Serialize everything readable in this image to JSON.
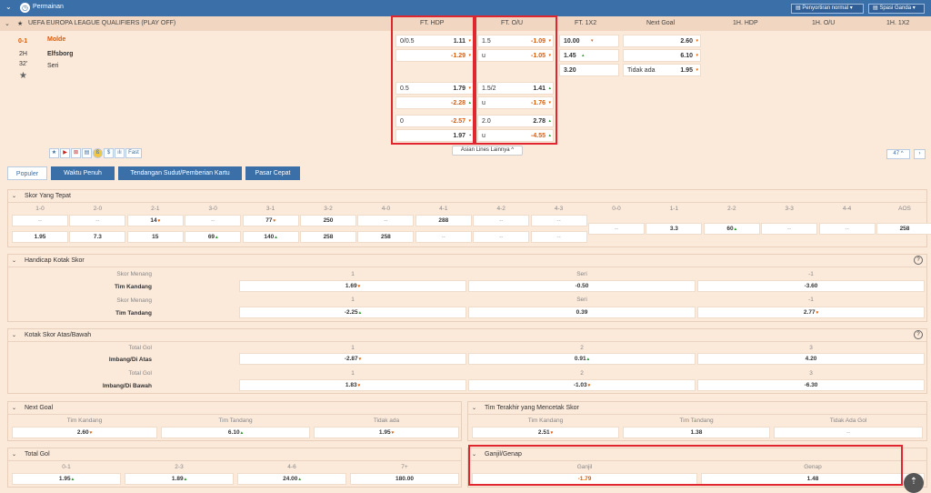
{
  "topbar": {
    "title": "Permainan",
    "sort": "Penyortiran normal",
    "spread": "Spasi Ganda"
  },
  "header": {
    "league": "UEFA EUROPA LEAGUE QUALIFIERS (PLAY OFF)",
    "cols": [
      "FT. HDP",
      "FT. O/U",
      "FT. 1X2",
      "Next Goal",
      "1H. HDP",
      "1H. O/U",
      "1H. 1X2"
    ]
  },
  "match": {
    "score": "0-1",
    "period": "2H",
    "minute": "32'",
    "home": "Molde",
    "away": "Elfsborg",
    "draw": "Seri"
  },
  "hdp": [
    {
      "line": "0/0.5",
      "home": "1.11",
      "away": "-1.29"
    },
    {
      "line": "0.5",
      "home": "1.79",
      "away": "-2.28"
    },
    {
      "line": "0",
      "home": "-2.57",
      "away": "1.97"
    }
  ],
  "ou": [
    {
      "line": "1.5",
      "over": "-1.09",
      "under": "-1.05",
      "u": "u"
    },
    {
      "line": "1.5/2",
      "over": "1.41",
      "under": "-1.76",
      "u": "u"
    },
    {
      "line": "2.0",
      "over": "2.78",
      "under": "-4.55",
      "u": "u"
    }
  ],
  "x12": {
    "home": "10.00",
    "away": "1.45",
    "draw": "3.20"
  },
  "nextgoal": {
    "home": "2.60",
    "away": "6.10",
    "none_label": "Tidak ada",
    "none": "1.95"
  },
  "asian_more": "Asian Lines Lainnya",
  "more_count": "47",
  "fast": "Fast",
  "tabs": [
    "Populer",
    "Waktu Penuh",
    "Tendangan Sudut/Pemberian Kartu",
    "Pasar Cepat"
  ],
  "correct_score": {
    "title": "Skor Yang Tepat",
    "labels": [
      "1-0",
      "2-0",
      "2-1",
      "3-0",
      "3-1",
      "3-2",
      "4-0",
      "4-1",
      "4-2",
      "4-3",
      "0-0",
      "1-1",
      "2-2",
      "3-3",
      "4-4",
      "AOS"
    ],
    "row1": [
      "--",
      "--",
      "14",
      "--",
      "77",
      "250",
      "--",
      "288",
      "--",
      "--"
    ],
    "row2": [
      "1.95",
      "7.3",
      "15",
      "69",
      "140",
      "258",
      "258",
      "--",
      "--",
      "--"
    ],
    "mid": [
      "--",
      "3.3",
      "60",
      "--",
      "--",
      "258"
    ]
  },
  "hcap": {
    "title": "Handicap Kotak Skor",
    "sub": "Skor Menang",
    "home": "Tim Kandang",
    "away": "Tim Tandang",
    "h": [
      "1",
      "Seri",
      "-1"
    ],
    "homev": [
      "1.69",
      "-0.50",
      "-3.60"
    ],
    "awayv": [
      "-2.25",
      "0.39",
      "2.77"
    ]
  },
  "ou_box": {
    "title": "Kotak Skor Atas/Bawah",
    "sub": "Total Gol",
    "over": "Imbang/Di Atas",
    "under": "Imbang/Di Bawah",
    "h": [
      "1",
      "2",
      "3"
    ],
    "overv": [
      "-2.87",
      "0.91",
      "4.20"
    ],
    "underv": [
      "1.83",
      "-1.03",
      "-6.30"
    ]
  },
  "next_goal": {
    "title": "Next Goal",
    "h": [
      "Tim Kandang",
      "Tim Tandang",
      "Tidak ada"
    ],
    "v": [
      "2.60",
      "6.10",
      "1.95"
    ]
  },
  "last_goal": {
    "title": "Tim Terakhir yang Mencetak Skor",
    "h": [
      "Tim Kandang",
      "Tim Tandang",
      "Tidak Ada Gol"
    ],
    "v": [
      "2.51",
      "1.38",
      "--"
    ]
  },
  "total_goal": {
    "title": "Total Gol",
    "h": [
      "0-1",
      "2-3",
      "4-6",
      "7+"
    ],
    "v": [
      "1.95",
      "1.89",
      "24.00",
      "180.00"
    ]
  },
  "odd_even": {
    "title": "Ganjil/Genap",
    "h": [
      "Ganjil",
      "Genap"
    ],
    "v": [
      "-1.79",
      "1.48"
    ]
  },
  "colors": {
    "accent": "#3a6fa8",
    "highlight": "#e0262e",
    "negative": "#e05a00"
  }
}
